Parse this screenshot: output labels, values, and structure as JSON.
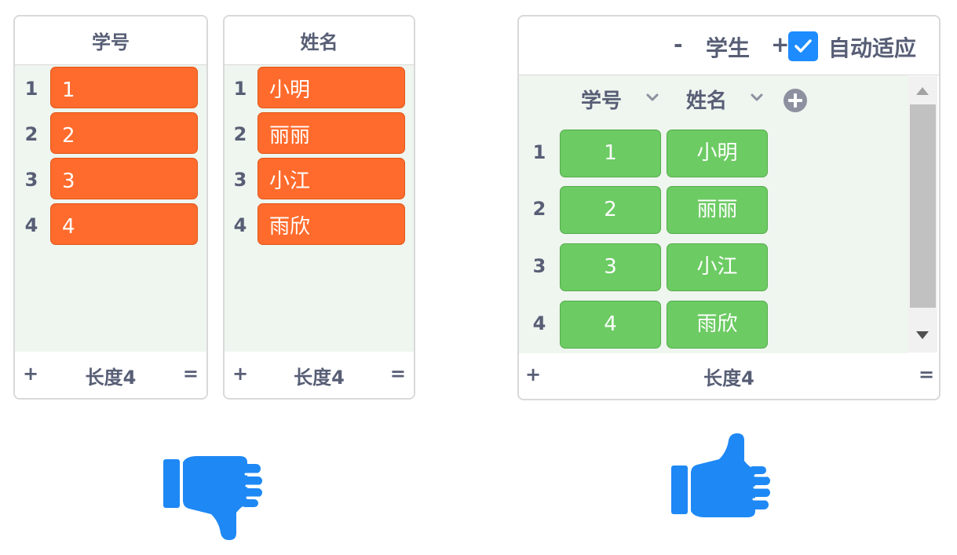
{
  "lists": [
    {
      "header": "学号",
      "rows": [
        {
          "index": "1",
          "value": "1"
        },
        {
          "index": "2",
          "value": "2"
        },
        {
          "index": "3",
          "value": "3"
        },
        {
          "index": "4",
          "value": "4"
        }
      ],
      "footer": {
        "add": "+",
        "length": "长度4",
        "resize": "="
      }
    },
    {
      "header": "姓名",
      "rows": [
        {
          "index": "1",
          "value": "小明"
        },
        {
          "index": "2",
          "value": "丽丽"
        },
        {
          "index": "3",
          "value": "小江"
        },
        {
          "index": "4",
          "value": "雨欣"
        }
      ],
      "footer": {
        "add": "+",
        "length": "长度4",
        "resize": "="
      }
    }
  ],
  "table": {
    "minus": "-",
    "title": "学生",
    "plus": "+",
    "auto_fit_label": "自动适应",
    "auto_fit_checked": true,
    "columns": [
      "学号",
      "姓名"
    ],
    "rows": [
      {
        "index": "1",
        "cells": [
          "1",
          "小明"
        ]
      },
      {
        "index": "2",
        "cells": [
          "2",
          "丽丽"
        ]
      },
      {
        "index": "3",
        "cells": [
          "3",
          "小江"
        ]
      },
      {
        "index": "4",
        "cells": [
          "4",
          "雨欣"
        ]
      }
    ],
    "footer": {
      "add": "+",
      "length": "长度4",
      "resize": "="
    }
  },
  "icons": {
    "left_hand": "thumbs-down-icon",
    "right_hand": "thumbs-up-icon"
  },
  "colors": {
    "orange_cell": "#ff6b2c",
    "green_cell": "#6ccb63",
    "accent_blue": "#1e8cff",
    "text": "#575e75",
    "body_bg": "#eff5ef"
  }
}
